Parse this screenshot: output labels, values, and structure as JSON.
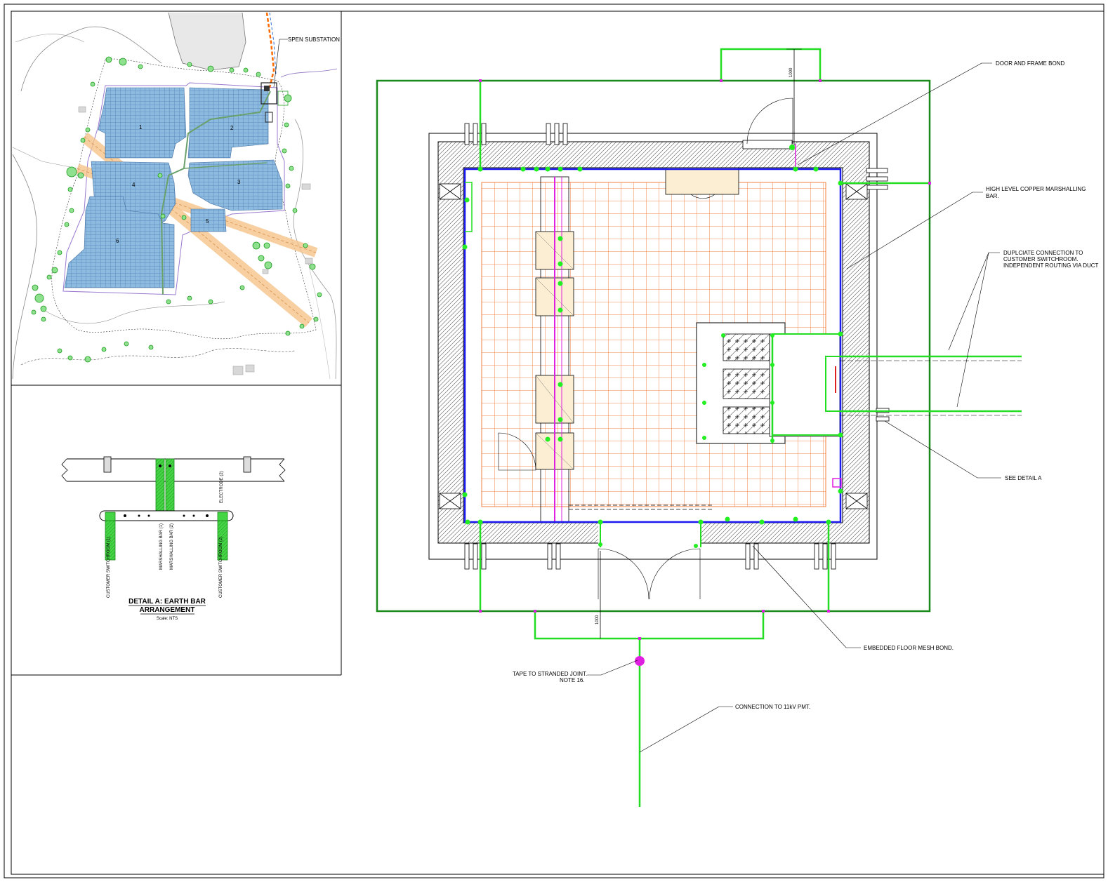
{
  "site_plan": {
    "substation_label": "SPEN SUBSTATION",
    "field_numbers": [
      "1",
      "2",
      "3",
      "4",
      "5",
      "6"
    ]
  },
  "detail_a": {
    "title": "DETAIL A: EARTH BAR",
    "title_line2": "ARRANGEMENT",
    "scale": "Scale: NTS",
    "labels": {
      "customer_1": "CUSTOMER SWITCHROOM (1)",
      "marshalling_1": "MARSHALLING BAR (1)",
      "marshalling_2": "MARSHALLING BAR (2)",
      "electrode": "ELECTRODE (2)",
      "customer_2": "CUSTOMER SWITCHROOM (2)"
    }
  },
  "plan": {
    "dim_top": "1000",
    "dim_bottom": "1000",
    "callouts": {
      "door_frame": "DOOR AND FRAME BOND",
      "marshalling_l1": "HIGH LEVEL COPPER MARSHALLING",
      "marshalling_l2": "BAR.",
      "duplicate_l1": "DUPLCIATE CONNECTION TO",
      "duplicate_l2": "CUSTOMER SWITCHROOM.",
      "duplicate_l3": "INDEPENDENT ROUTING VIA DUCT",
      "see_detail": "SEE DETAIL A",
      "mesh_bond": "EMBEDDED FLOOR MESH BOND.",
      "tape_l1": "TAPE TO STRANDED JOINT.",
      "tape_l2": "NOTE 16.",
      "connection": "CONNECTION TO 11kV PMT."
    }
  },
  "colors": {
    "earth_green": "#22dd22",
    "marshalling_blue": "#1a1aee",
    "mesh_orange": "#f08040",
    "bond_magenta": "#e020e0",
    "panel_blue": "#7fb0d8"
  }
}
